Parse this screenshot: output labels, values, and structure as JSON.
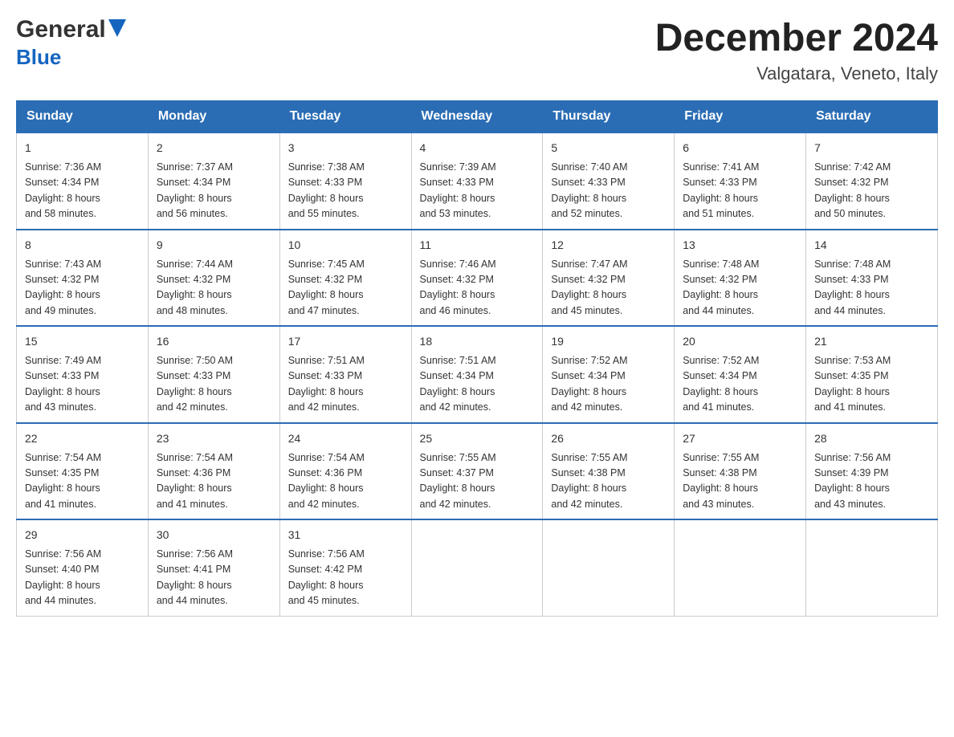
{
  "header": {
    "logo_general": "General",
    "logo_blue": "Blue",
    "main_title": "December 2024",
    "subtitle": "Valgatara, Veneto, Italy"
  },
  "calendar": {
    "days_of_week": [
      "Sunday",
      "Monday",
      "Tuesday",
      "Wednesday",
      "Thursday",
      "Friday",
      "Saturday"
    ],
    "weeks": [
      [
        {
          "day": "1",
          "sunrise": "7:36 AM",
          "sunset": "4:34 PM",
          "daylight": "8 hours and 58 minutes."
        },
        {
          "day": "2",
          "sunrise": "7:37 AM",
          "sunset": "4:34 PM",
          "daylight": "8 hours and 56 minutes."
        },
        {
          "day": "3",
          "sunrise": "7:38 AM",
          "sunset": "4:33 PM",
          "daylight": "8 hours and 55 minutes."
        },
        {
          "day": "4",
          "sunrise": "7:39 AM",
          "sunset": "4:33 PM",
          "daylight": "8 hours and 53 minutes."
        },
        {
          "day": "5",
          "sunrise": "7:40 AM",
          "sunset": "4:33 PM",
          "daylight": "8 hours and 52 minutes."
        },
        {
          "day": "6",
          "sunrise": "7:41 AM",
          "sunset": "4:33 PM",
          "daylight": "8 hours and 51 minutes."
        },
        {
          "day": "7",
          "sunrise": "7:42 AM",
          "sunset": "4:32 PM",
          "daylight": "8 hours and 50 minutes."
        }
      ],
      [
        {
          "day": "8",
          "sunrise": "7:43 AM",
          "sunset": "4:32 PM",
          "daylight": "8 hours and 49 minutes."
        },
        {
          "day": "9",
          "sunrise": "7:44 AM",
          "sunset": "4:32 PM",
          "daylight": "8 hours and 48 minutes."
        },
        {
          "day": "10",
          "sunrise": "7:45 AM",
          "sunset": "4:32 PM",
          "daylight": "8 hours and 47 minutes."
        },
        {
          "day": "11",
          "sunrise": "7:46 AM",
          "sunset": "4:32 PM",
          "daylight": "8 hours and 46 minutes."
        },
        {
          "day": "12",
          "sunrise": "7:47 AM",
          "sunset": "4:32 PM",
          "daylight": "8 hours and 45 minutes."
        },
        {
          "day": "13",
          "sunrise": "7:48 AM",
          "sunset": "4:32 PM",
          "daylight": "8 hours and 44 minutes."
        },
        {
          "day": "14",
          "sunrise": "7:48 AM",
          "sunset": "4:33 PM",
          "daylight": "8 hours and 44 minutes."
        }
      ],
      [
        {
          "day": "15",
          "sunrise": "7:49 AM",
          "sunset": "4:33 PM",
          "daylight": "8 hours and 43 minutes."
        },
        {
          "day": "16",
          "sunrise": "7:50 AM",
          "sunset": "4:33 PM",
          "daylight": "8 hours and 42 minutes."
        },
        {
          "day": "17",
          "sunrise": "7:51 AM",
          "sunset": "4:33 PM",
          "daylight": "8 hours and 42 minutes."
        },
        {
          "day": "18",
          "sunrise": "7:51 AM",
          "sunset": "4:34 PM",
          "daylight": "8 hours and 42 minutes."
        },
        {
          "day": "19",
          "sunrise": "7:52 AM",
          "sunset": "4:34 PM",
          "daylight": "8 hours and 42 minutes."
        },
        {
          "day": "20",
          "sunrise": "7:52 AM",
          "sunset": "4:34 PM",
          "daylight": "8 hours and 41 minutes."
        },
        {
          "day": "21",
          "sunrise": "7:53 AM",
          "sunset": "4:35 PM",
          "daylight": "8 hours and 41 minutes."
        }
      ],
      [
        {
          "day": "22",
          "sunrise": "7:54 AM",
          "sunset": "4:35 PM",
          "daylight": "8 hours and 41 minutes."
        },
        {
          "day": "23",
          "sunrise": "7:54 AM",
          "sunset": "4:36 PM",
          "daylight": "8 hours and 41 minutes."
        },
        {
          "day": "24",
          "sunrise": "7:54 AM",
          "sunset": "4:36 PM",
          "daylight": "8 hours and 42 minutes."
        },
        {
          "day": "25",
          "sunrise": "7:55 AM",
          "sunset": "4:37 PM",
          "daylight": "8 hours and 42 minutes."
        },
        {
          "day": "26",
          "sunrise": "7:55 AM",
          "sunset": "4:38 PM",
          "daylight": "8 hours and 42 minutes."
        },
        {
          "day": "27",
          "sunrise": "7:55 AM",
          "sunset": "4:38 PM",
          "daylight": "8 hours and 43 minutes."
        },
        {
          "day": "28",
          "sunrise": "7:56 AM",
          "sunset": "4:39 PM",
          "daylight": "8 hours and 43 minutes."
        }
      ],
      [
        {
          "day": "29",
          "sunrise": "7:56 AM",
          "sunset": "4:40 PM",
          "daylight": "8 hours and 44 minutes."
        },
        {
          "day": "30",
          "sunrise": "7:56 AM",
          "sunset": "4:41 PM",
          "daylight": "8 hours and 44 minutes."
        },
        {
          "day": "31",
          "sunrise": "7:56 AM",
          "sunset": "4:42 PM",
          "daylight": "8 hours and 45 minutes."
        },
        null,
        null,
        null,
        null
      ]
    ],
    "labels": {
      "sunrise": "Sunrise: ",
      "sunset": "Sunset: ",
      "daylight": "Daylight: "
    }
  }
}
